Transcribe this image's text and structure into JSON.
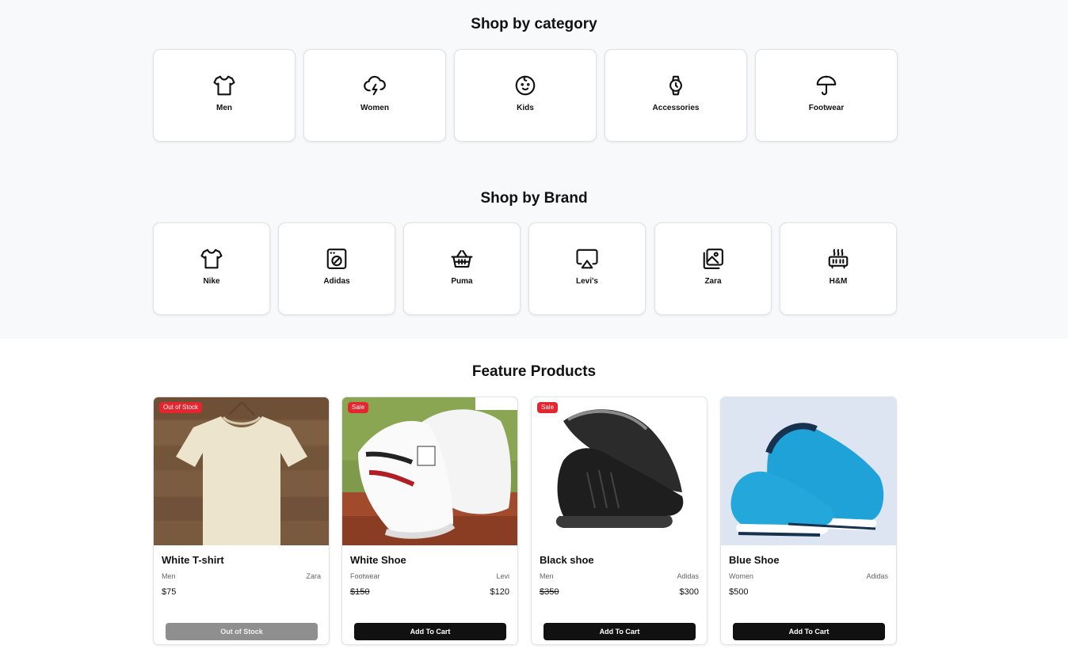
{
  "categories": {
    "title": "Shop by category",
    "items": [
      {
        "label": "Men",
        "icon": "tshirt-icon"
      },
      {
        "label": "Women",
        "icon": "cloud-lightning-icon"
      },
      {
        "label": "Kids",
        "icon": "baby-face-icon"
      },
      {
        "label": "Accessories",
        "icon": "watch-icon"
      },
      {
        "label": "Footwear",
        "icon": "umbrella-icon"
      }
    ]
  },
  "brands": {
    "title": "Shop by Brand",
    "items": [
      {
        "label": "Nike",
        "icon": "tshirt-icon"
      },
      {
        "label": "Adidas",
        "icon": "washing-machine-icon"
      },
      {
        "label": "Puma",
        "icon": "basket-icon"
      },
      {
        "label": "Levi's",
        "icon": "airplay-icon"
      },
      {
        "label": "Zara",
        "icon": "gallery-icon"
      },
      {
        "label": "H&M",
        "icon": "heater-icon"
      }
    ]
  },
  "featured": {
    "title": "Feature Products",
    "products": [
      {
        "name": "White T-shirt",
        "category": "Men",
        "brand": "Zara",
        "price": "$75",
        "old_price": "",
        "badge": "Out of Stock",
        "button": "Out of Stock",
        "in_stock": false,
        "image": "white-tshirt-image"
      },
      {
        "name": "White Shoe",
        "category": "Footwear",
        "brand": "Levi",
        "price": "$120",
        "old_price": "$150",
        "badge": "Sale",
        "button": "Add To Cart",
        "in_stock": true,
        "image": "white-shoe-image"
      },
      {
        "name": "Black shoe",
        "category": "Men",
        "brand": "Adidas",
        "price": "$300",
        "old_price": "$350",
        "badge": "Sale",
        "button": "Add To Cart",
        "in_stock": true,
        "image": "black-shoe-image"
      },
      {
        "name": "Blue Shoe",
        "category": "Women",
        "brand": "Adidas",
        "price": "$500",
        "old_price": "",
        "badge": "",
        "button": "Add To Cart",
        "in_stock": true,
        "image": "blue-shoe-image"
      }
    ]
  },
  "colors": {
    "page_bg": "#f8f9fb",
    "badge": "#e5262f",
    "button": "#111111",
    "button_disabled": "#8f8f8f"
  }
}
